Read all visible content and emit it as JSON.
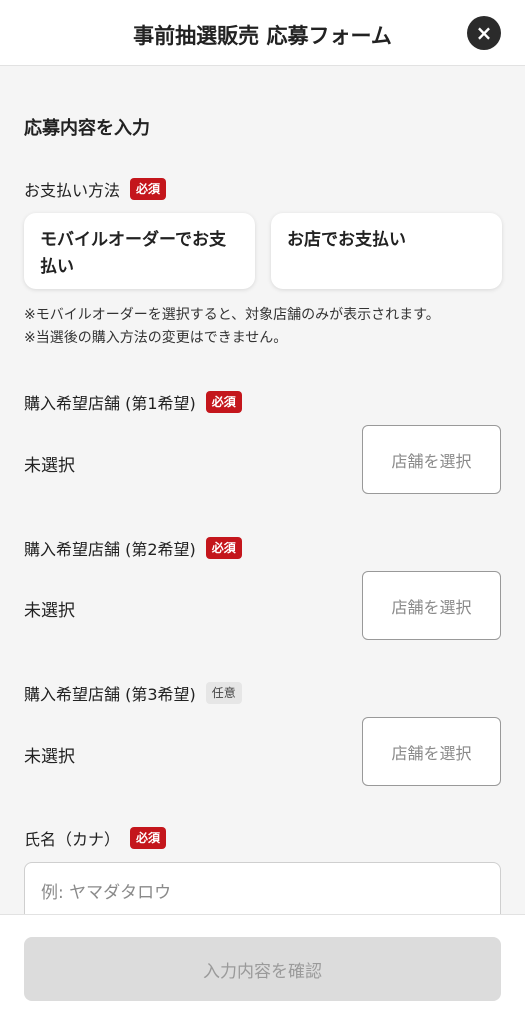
{
  "header": {
    "title": "事前抽選販売 応募フォーム",
    "close_icon": "×"
  },
  "form": {
    "section_title": "応募内容を入力",
    "payment": {
      "label": "お支払い方法",
      "badge": "必須",
      "options": [
        "モバイルオーダーでお支払い",
        "お店でお支払い"
      ],
      "notes": [
        "※モバイルオーダーを選択すると、対象店舗のみが表示されます。",
        "※当選後の購入方法の変更はできません。"
      ]
    },
    "stores": [
      {
        "label": "購入希望店舗 (第1希望)",
        "badge": "必須",
        "value": "未選択",
        "button": "店舗を選択"
      },
      {
        "label": "購入希望店舗 (第2希望)",
        "badge": "必須",
        "value": "未選択",
        "button": "店舗を選択"
      },
      {
        "label": "購入希望店舗 (第3希望)",
        "badge": "任意",
        "value": "未選択",
        "button": "店舗を選択"
      }
    ],
    "name_kana": {
      "label": "氏名（カナ）",
      "badge": "必須",
      "placeholder": "例: ヤマダタロウ",
      "value": ""
    }
  },
  "footer": {
    "confirm_label": "入力内容を確認"
  },
  "colors": {
    "required": "#c4161c",
    "background": "#f5f5f5",
    "disabled_button": "#dcdcdc"
  }
}
